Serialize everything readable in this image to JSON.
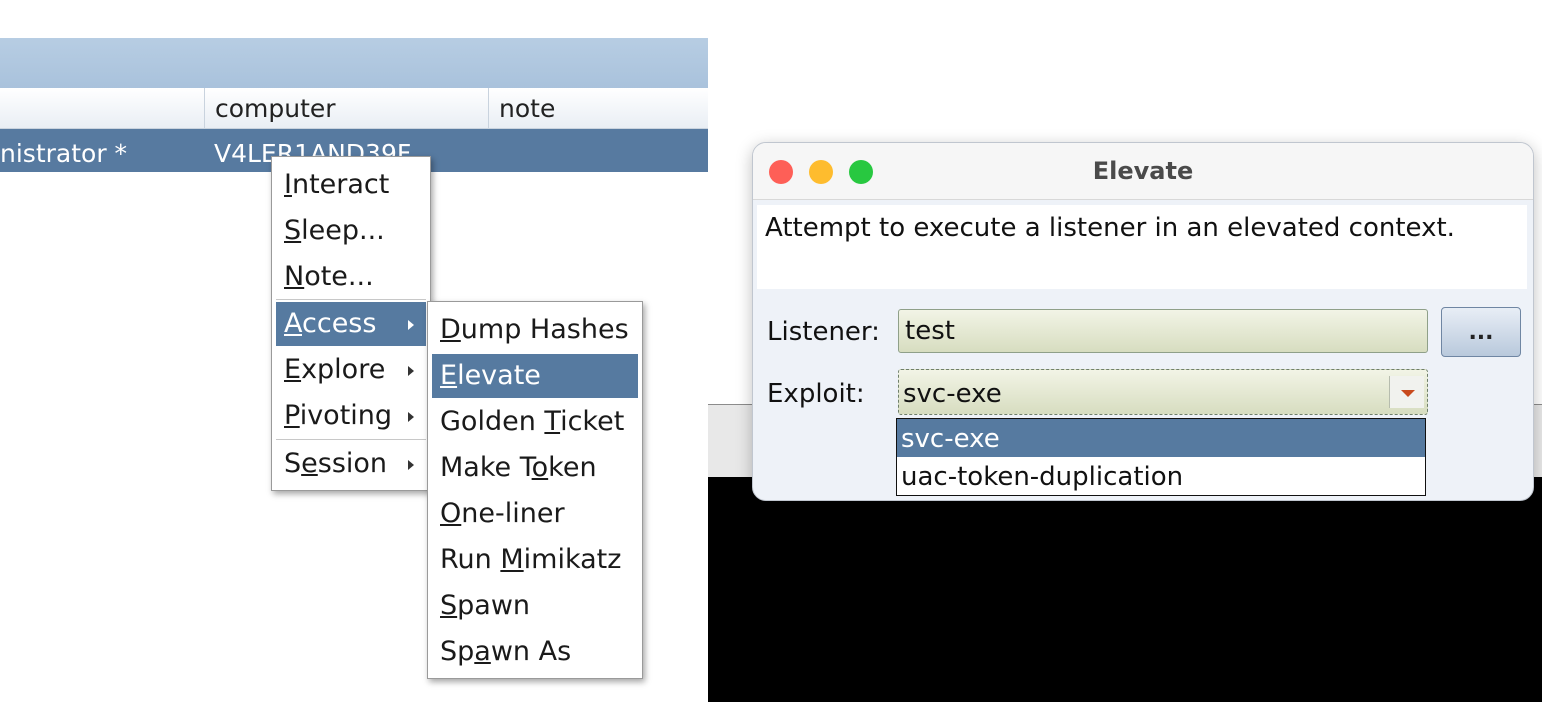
{
  "table": {
    "headers": [
      "computer",
      "note"
    ],
    "row": {
      "user": "nistrator *",
      "computer": "V4LER1AND39F"
    }
  },
  "context_menu": {
    "items": [
      {
        "pre": "",
        "key": "I",
        "post": "nteract",
        "submenu": false
      },
      {
        "pre": "",
        "key": "S",
        "post": "leep...",
        "submenu": false
      },
      {
        "pre": "",
        "key": "N",
        "post": "ote...",
        "submenu": false
      },
      {
        "pre": "",
        "key": "A",
        "post": "ccess",
        "submenu": true,
        "selected": true
      },
      {
        "pre": "",
        "key": "E",
        "post": "xplore",
        "submenu": true
      },
      {
        "pre": "",
        "key": "P",
        "post": "ivoting",
        "submenu": true
      },
      {
        "pre": "S",
        "key": "e",
        "post": "ssion",
        "submenu": true
      }
    ]
  },
  "access_submenu": {
    "items": [
      {
        "pre": "",
        "key": "D",
        "post": "ump Hashes"
      },
      {
        "pre": "",
        "key": "E",
        "post": "levate",
        "selected": true
      },
      {
        "pre": "Golden ",
        "key": "T",
        "post": "icket"
      },
      {
        "pre": "Make T",
        "key": "o",
        "post": "ken"
      },
      {
        "pre": "",
        "key": "O",
        "post": "ne-liner"
      },
      {
        "pre": "Run ",
        "key": "M",
        "post": "imikatz"
      },
      {
        "pre": "",
        "key": "S",
        "post": "pawn"
      },
      {
        "pre": "Sp",
        "key": "a",
        "post": "wn As"
      }
    ]
  },
  "dialog": {
    "title": "Elevate",
    "description": "Attempt to execute a listener in an elevated context.",
    "listener_label": "Listener:",
    "listener_value": "test",
    "browse_label": "...",
    "exploit_label": "Exploit:",
    "exploit_value": "svc-exe",
    "exploit_options": [
      "svc-exe",
      "uac-token-duplication"
    ]
  },
  "colors": {
    "selection": "#567aa0",
    "traffic_red": "#fe5f57",
    "traffic_yellow": "#febc2e",
    "traffic_green": "#28c840"
  }
}
